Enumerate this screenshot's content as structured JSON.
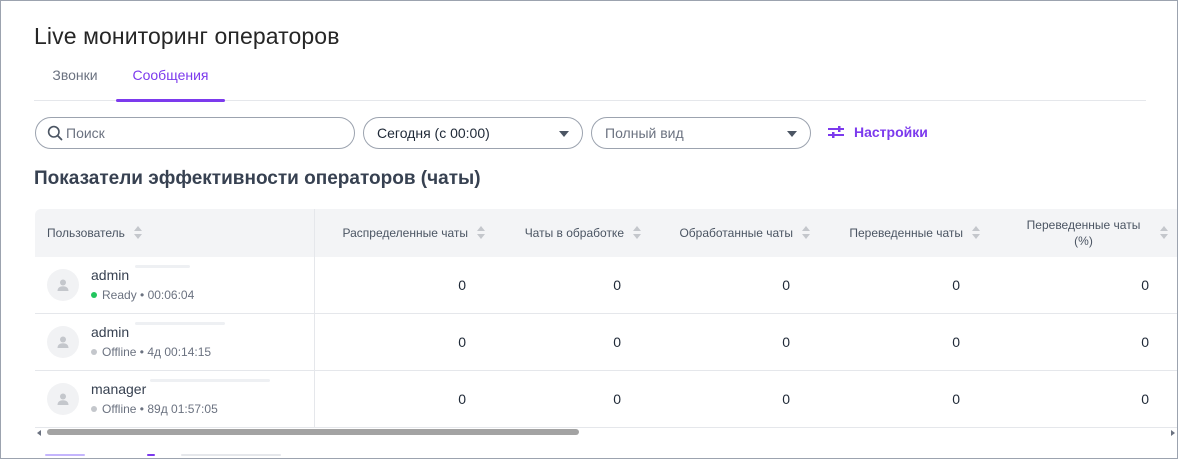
{
  "page": {
    "title": "Live мониторинг операторов"
  },
  "tabs": [
    {
      "label": "Звонки",
      "active": false
    },
    {
      "label": "Сообщения",
      "active": true
    }
  ],
  "toolbar": {
    "search_placeholder": "Поиск",
    "period_value": "Сегодня (с 00:00)",
    "view_value": "Полный вид",
    "settings_label": "Настройки"
  },
  "section": {
    "title": "Показатели эффективности операторов (чаты)"
  },
  "table": {
    "columns": [
      "Пользователь",
      "Распределенные чаты",
      "Чаты в обработке",
      "Обработанные чаты",
      "Переведенные чаты",
      "Переведенные чаты (%)"
    ],
    "rows": [
      {
        "name": "admin",
        "status": "Ready",
        "status_color": "#22c55e",
        "time": "00:06:04",
        "values": [
          "0",
          "0",
          "0",
          "0",
          "0"
        ]
      },
      {
        "name": "admin",
        "status": "Offline",
        "status_color": "#c4c7cc",
        "time": "4д 00:14:15",
        "values": [
          "0",
          "0",
          "0",
          "0",
          "0"
        ]
      },
      {
        "name": "manager",
        "status": "Offline",
        "status_color": "#c4c7cc",
        "time": "89д 01:57:05",
        "values": [
          "0",
          "0",
          "0",
          "0",
          "0"
        ]
      }
    ]
  },
  "colors": {
    "accent": "#7c3aed",
    "ready": "#22c55e",
    "offline": "#c4c7cc"
  }
}
